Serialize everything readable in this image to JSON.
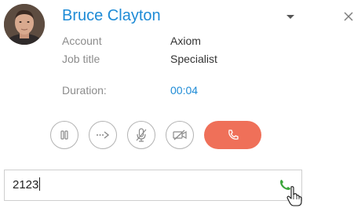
{
  "contact": {
    "name": "Bruce Clayton",
    "fields": [
      {
        "label": "Account",
        "value": "Axiom"
      },
      {
        "label": "Job title",
        "value": "Specialist"
      }
    ],
    "duration_label": "Duration:",
    "duration_value": "00:04"
  },
  "controls": {
    "icons": [
      "pause-icon",
      "transfer-icon",
      "mute-microphone-icon",
      "video-off-icon",
      "hang-up-icon"
    ]
  },
  "dialer": {
    "input_value": "2123",
    "call_icon": "phone-icon"
  },
  "colors": {
    "accent": "#1e8bd6",
    "hangup": "#ef7059",
    "call_green": "#3aa53a",
    "label_gray": "#8c8c8c"
  }
}
